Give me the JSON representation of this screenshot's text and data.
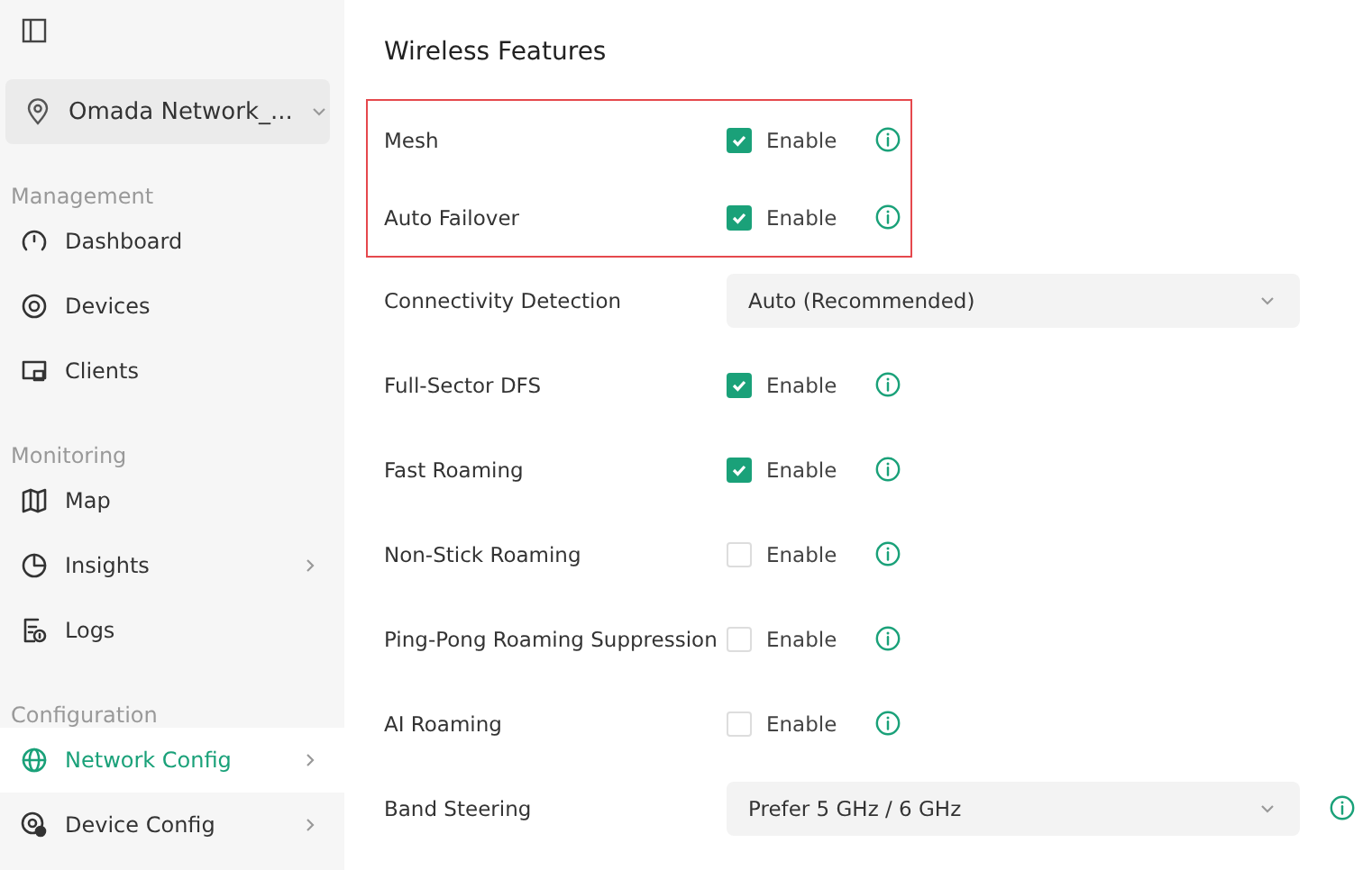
{
  "sidebar": {
    "site_selector": {
      "value": "Omada Network_..."
    },
    "sections": [
      {
        "title": "Management",
        "items": [
          {
            "label": "Dashboard",
            "selected": false,
            "submenu": false
          },
          {
            "label": "Devices",
            "selected": false,
            "submenu": false
          },
          {
            "label": "Clients",
            "selected": false,
            "submenu": false
          }
        ]
      },
      {
        "title": "Monitoring",
        "items": [
          {
            "label": "Map",
            "selected": false,
            "submenu": false
          },
          {
            "label": "Insights",
            "selected": false,
            "submenu": true
          },
          {
            "label": "Logs",
            "selected": false,
            "submenu": false
          }
        ]
      },
      {
        "title": "Configuration",
        "items": [
          {
            "label": "Network Config",
            "selected": true,
            "submenu": true
          },
          {
            "label": "Device Config",
            "selected": false,
            "submenu": true
          }
        ]
      }
    ]
  },
  "main": {
    "title": "Wireless Features",
    "rows": [
      {
        "kind": "checkbox",
        "label": "Mesh",
        "checked": true,
        "option": "Enable",
        "info": true,
        "highlighted": true
      },
      {
        "kind": "checkbox",
        "label": "Auto Failover",
        "checked": true,
        "option": "Enable",
        "info": true,
        "highlighted": true
      },
      {
        "kind": "select",
        "label": "Connectivity Detection",
        "value": "Auto (Recommended)",
        "info": false,
        "highlighted": false
      },
      {
        "kind": "checkbox",
        "label": "Full-Sector DFS",
        "checked": true,
        "option": "Enable",
        "info": true,
        "highlighted": false
      },
      {
        "kind": "checkbox",
        "label": "Fast Roaming",
        "checked": true,
        "option": "Enable",
        "info": true,
        "highlighted": false
      },
      {
        "kind": "checkbox",
        "label": "Non-Stick Roaming",
        "checked": false,
        "option": "Enable",
        "info": true,
        "highlighted": false
      },
      {
        "kind": "checkbox",
        "label": "Ping-Pong Roaming Suppression",
        "checked": false,
        "option": "Enable",
        "info": true,
        "highlighted": false
      },
      {
        "kind": "checkbox",
        "label": "AI Roaming",
        "checked": false,
        "option": "Enable",
        "info": true,
        "highlighted": false
      },
      {
        "kind": "select",
        "label": "Band Steering",
        "value": "Prefer 5 GHz / 6 GHz",
        "info": true,
        "highlighted": false
      }
    ]
  }
}
